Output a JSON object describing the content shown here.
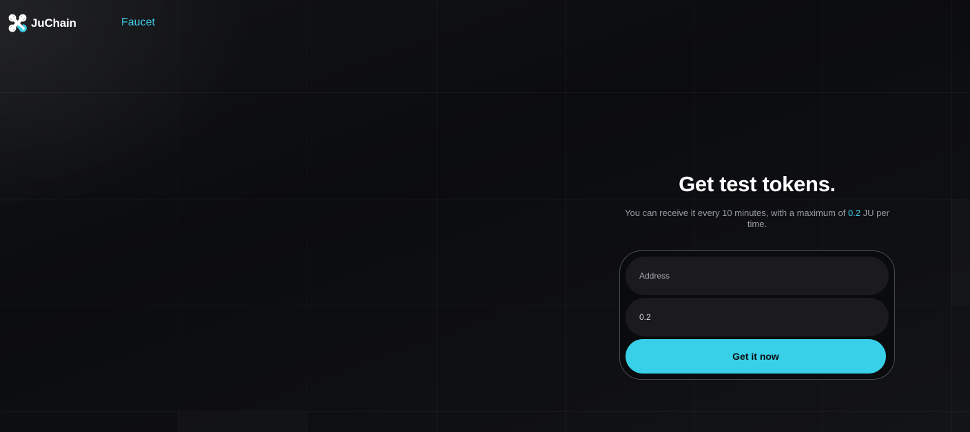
{
  "brand": {
    "name": "JuChain",
    "logo_icon": "juchain-logo-icon",
    "accent_color": "#3dcde8"
  },
  "nav": {
    "faucet_label": "Faucet"
  },
  "faucet": {
    "title": "Get test tokens.",
    "subtitle_prefix": "You can receive it every 10 minutes, with a maximum of ",
    "subtitle_amount": "0.2",
    "subtitle_suffix": " JU per time.",
    "address_placeholder": "Address",
    "amount_value": "0.2",
    "submit_label": "Get it now",
    "button_color": "#38d0e9"
  }
}
